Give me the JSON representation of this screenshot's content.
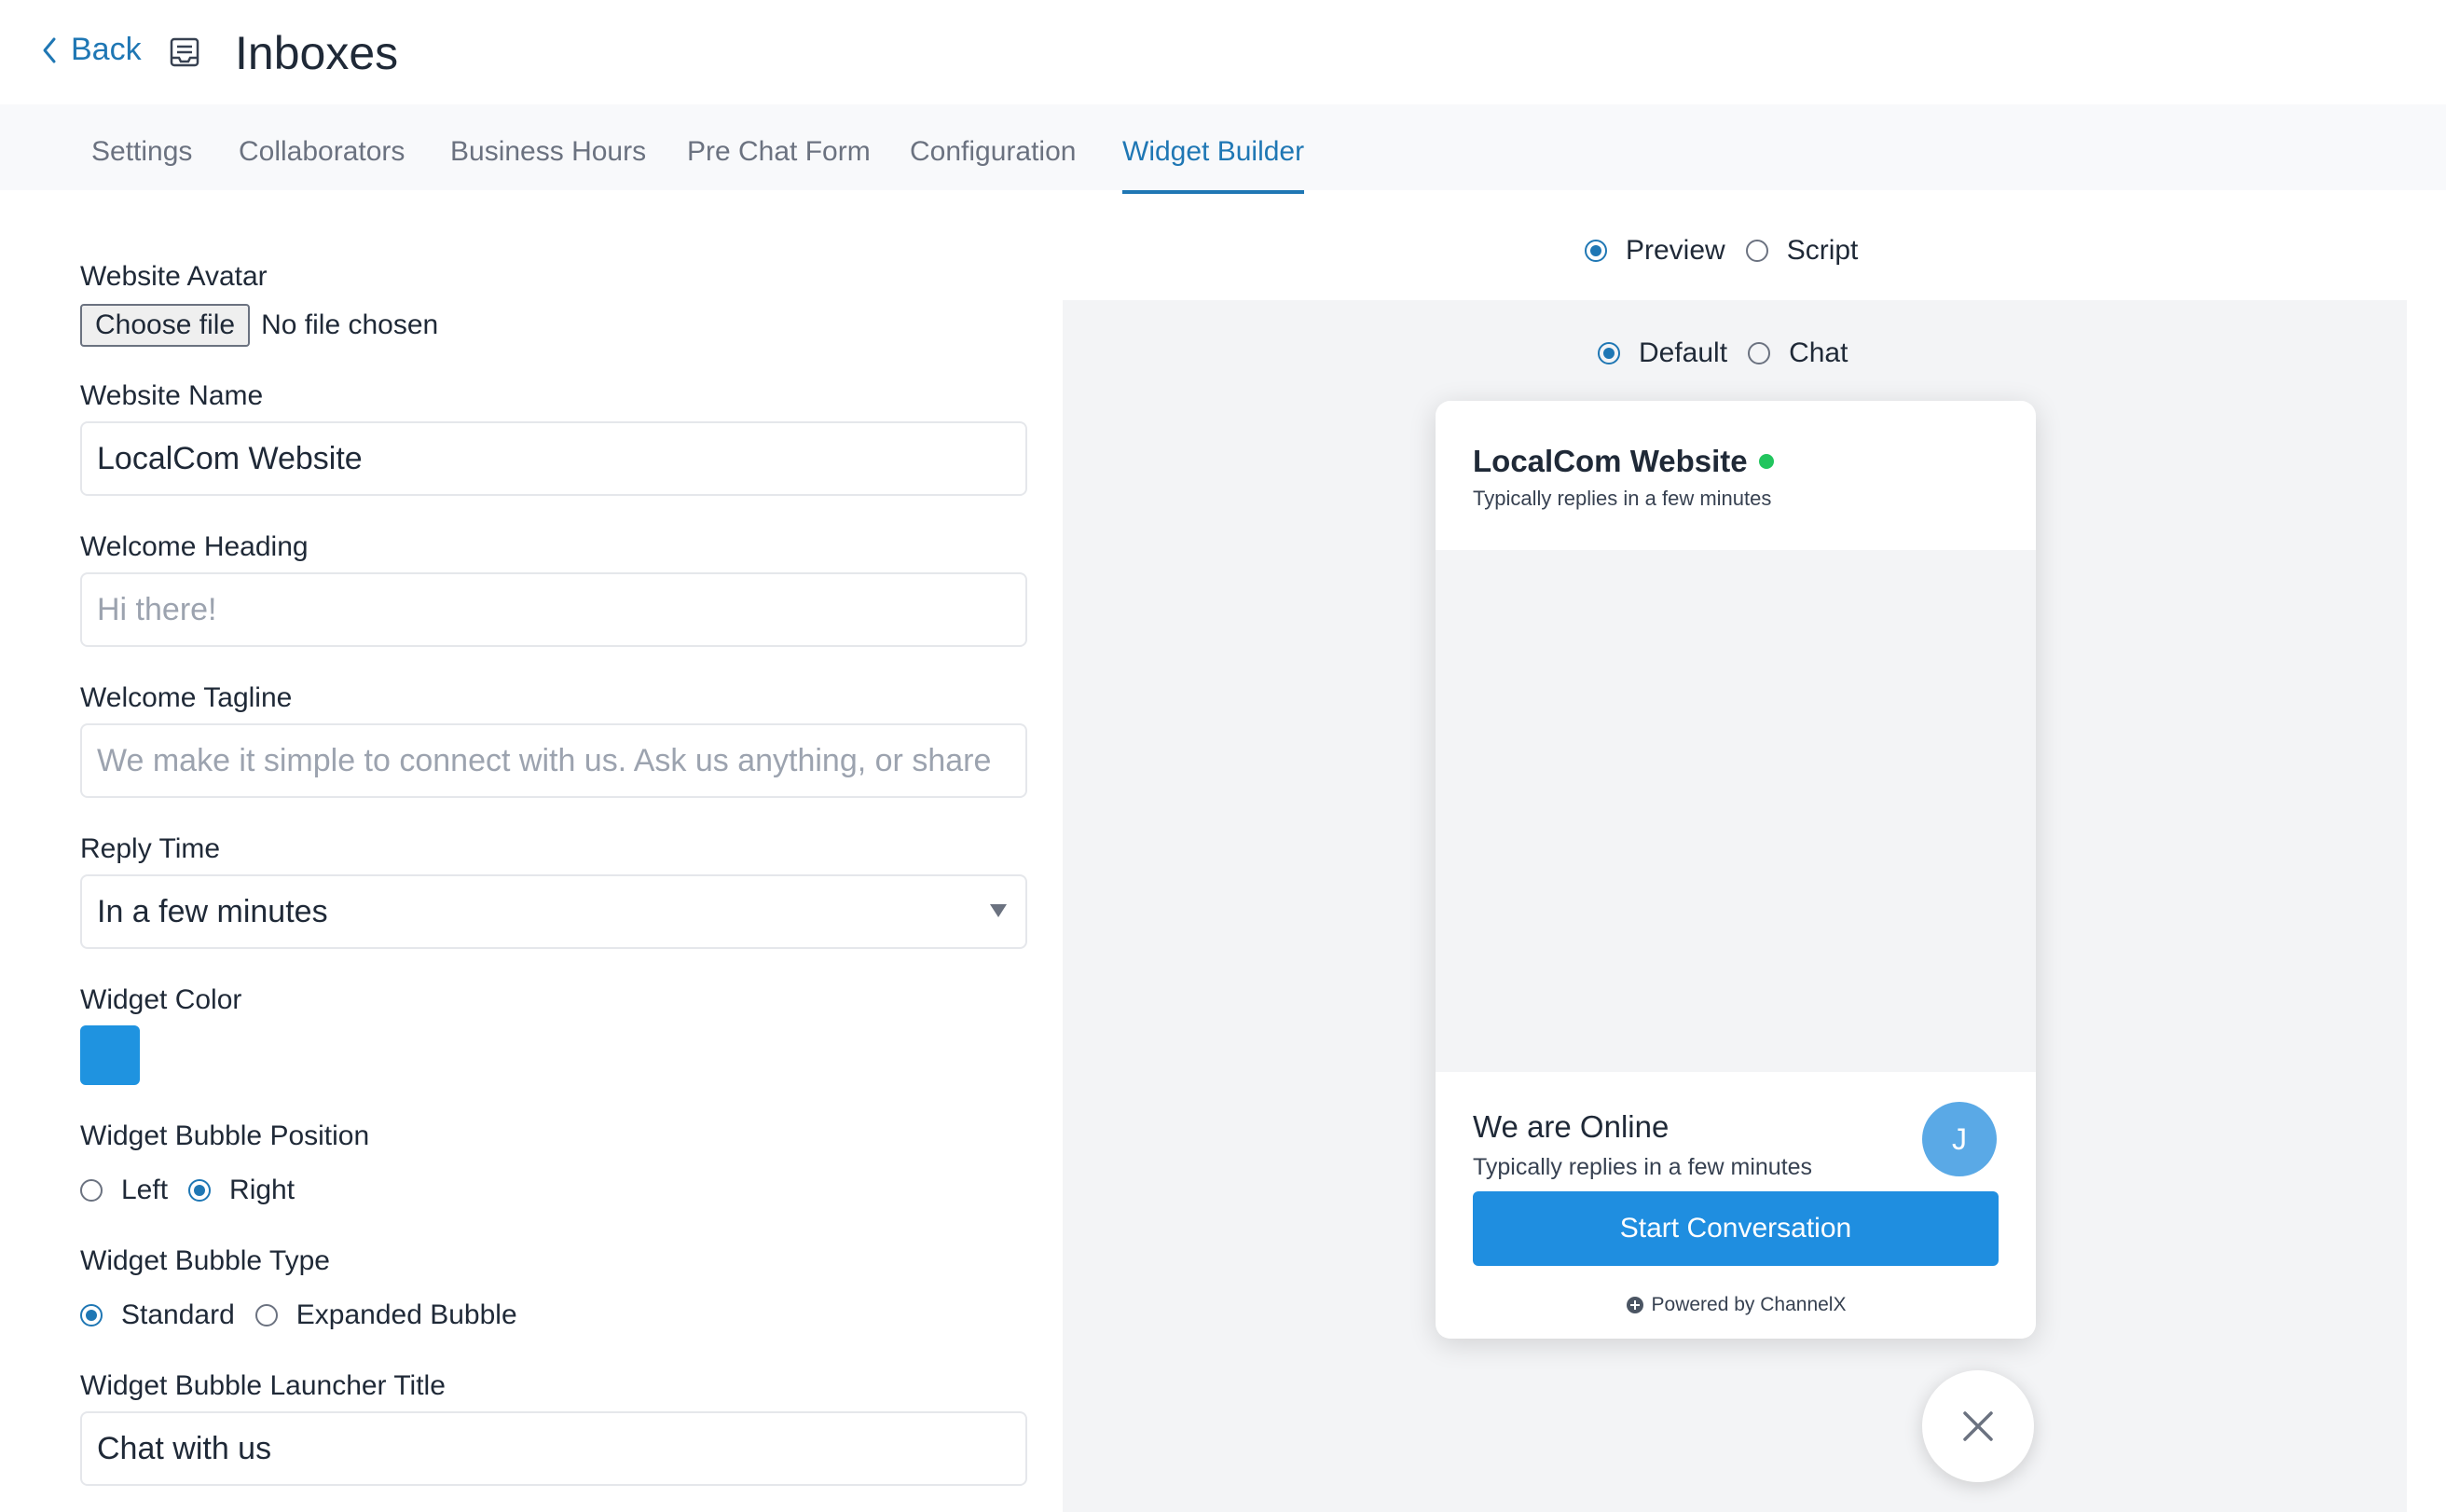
{
  "header": {
    "back_label": "Back",
    "title": "Inboxes"
  },
  "tabs": [
    {
      "label": "Settings"
    },
    {
      "label": "Collaborators"
    },
    {
      "label": "Business Hours"
    },
    {
      "label": "Pre Chat Form"
    },
    {
      "label": "Configuration"
    },
    {
      "label": "Widget Builder",
      "active": true
    }
  ],
  "form": {
    "avatar_label": "Website Avatar",
    "choose_file": "Choose file",
    "no_file": "No file chosen",
    "name_label": "Website Name",
    "name_value": "LocalCom Website",
    "heading_label": "Welcome Heading",
    "heading_placeholder": "Hi there!",
    "tagline_label": "Welcome Tagline",
    "tagline_placeholder": "We make it simple to connect with us. Ask us anything, or share",
    "reply_label": "Reply Time",
    "reply_value": "In a few minutes",
    "color_label": "Widget Color",
    "color_value": "#1f93e0",
    "position_label": "Widget Bubble Position",
    "position_left": "Left",
    "position_right": "Right",
    "position_selected": "Right",
    "type_label": "Widget Bubble Type",
    "type_standard": "Standard",
    "type_expanded": "Expanded Bubble",
    "type_selected": "Standard",
    "launcher_label": "Widget Bubble Launcher Title",
    "launcher_value": "Chat with us"
  },
  "preview": {
    "mode_preview": "Preview",
    "mode_script": "Script",
    "mode_selected": "Preview",
    "view_default": "Default",
    "view_chat": "Chat",
    "view_selected": "Default"
  },
  "widget": {
    "name": "LocalCom Website",
    "reply_text": "Typically replies in a few minutes",
    "online_title": "We are Online",
    "online_reply": "Typically replies in a few minutes",
    "avatar_initial": "J",
    "start_button": "Start Conversation",
    "powered_by": "Powered by ChannelX"
  },
  "colors": {
    "accent": "#1f77b4",
    "widget": "#1f8ee0",
    "online": "#22c55e"
  }
}
